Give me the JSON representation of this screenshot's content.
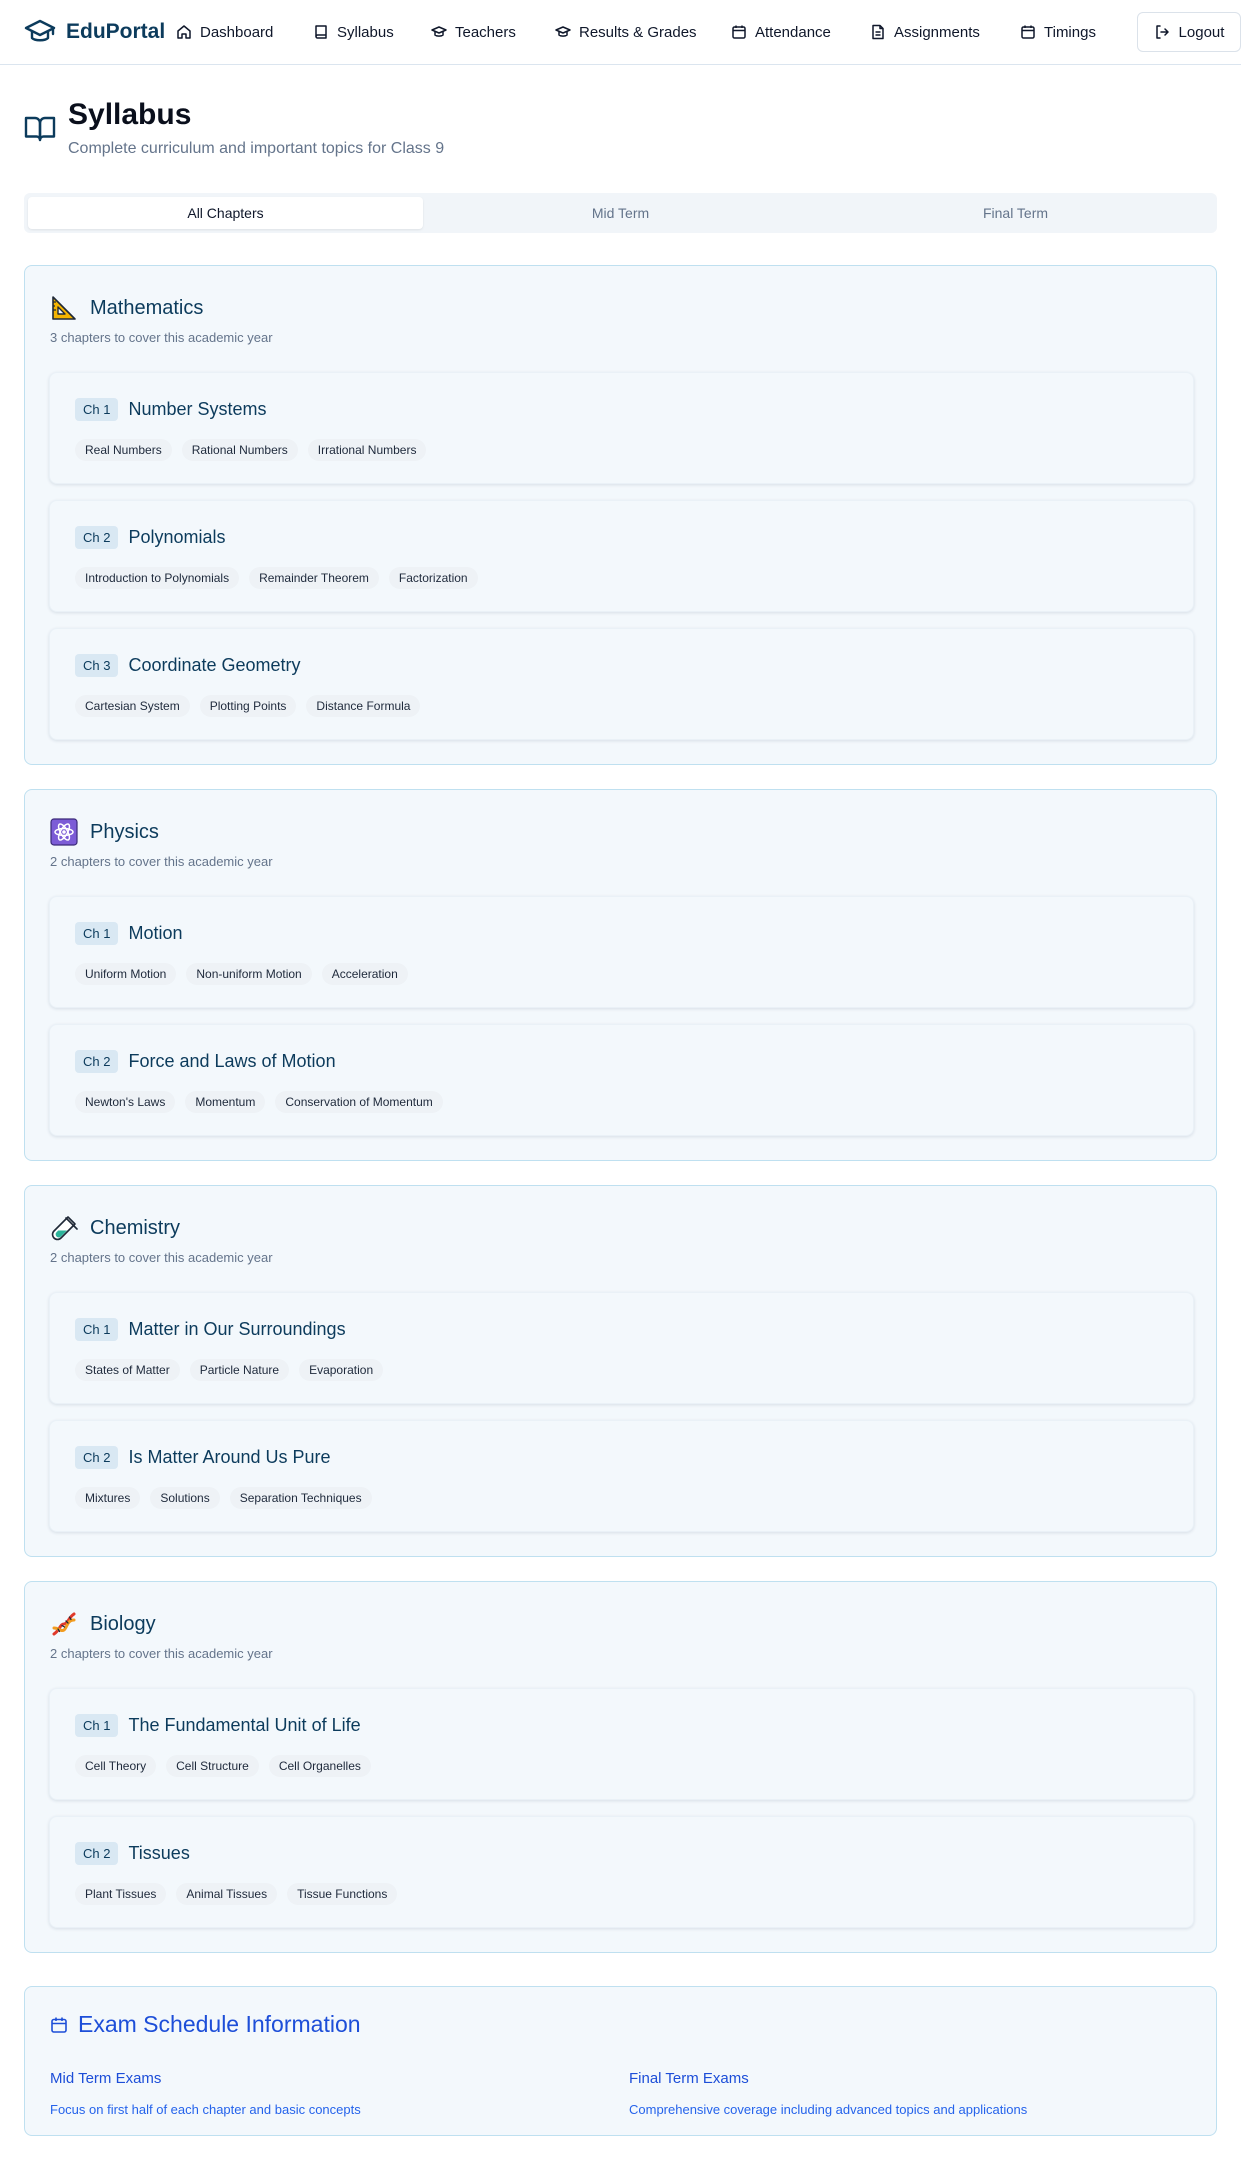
{
  "app": {
    "name": "EduPortal"
  },
  "nav": {
    "items": [
      {
        "label": "Dashboard",
        "icon": "home-icon"
      },
      {
        "label": "Syllabus",
        "icon": "book-icon"
      },
      {
        "label": "Teachers",
        "icon": "graduation-cap-icon"
      },
      {
        "label": "Results & Grades",
        "icon": "graduation-cap-icon"
      },
      {
        "label": "Attendance",
        "icon": "calendar-icon"
      },
      {
        "label": "Assignments",
        "icon": "document-icon"
      },
      {
        "label": "Timings",
        "icon": "calendar-icon"
      }
    ],
    "logout_label": "Logout"
  },
  "page": {
    "title": "Syllabus",
    "subtitle": "Complete curriculum and important topics for Class 9"
  },
  "tabs": [
    {
      "label": "All Chapters",
      "active": true
    },
    {
      "label": "Mid Term",
      "active": false
    },
    {
      "label": "Final Term",
      "active": false
    }
  ],
  "subjects": [
    {
      "name": "Mathematics",
      "icon": "triangle-ruler-icon",
      "description": "3 chapters to cover this academic year",
      "chapters": [
        {
          "badge": "Ch 1",
          "title": "Number Systems",
          "topics": [
            "Real Numbers",
            "Rational Numbers",
            "Irrational Numbers"
          ]
        },
        {
          "badge": "Ch 2",
          "title": "Polynomials",
          "topics": [
            "Introduction to Polynomials",
            "Remainder Theorem",
            "Factorization"
          ]
        },
        {
          "badge": "Ch 3",
          "title": "Coordinate Geometry",
          "topics": [
            "Cartesian System",
            "Plotting Points",
            "Distance Formula"
          ]
        }
      ]
    },
    {
      "name": "Physics",
      "icon": "atom-icon",
      "description": "2 chapters to cover this academic year",
      "chapters": [
        {
          "badge": "Ch 1",
          "title": "Motion",
          "topics": [
            "Uniform Motion",
            "Non-uniform Motion",
            "Acceleration"
          ]
        },
        {
          "badge": "Ch 2",
          "title": "Force and Laws of Motion",
          "topics": [
            "Newton's Laws",
            "Momentum",
            "Conservation of Momentum"
          ]
        }
      ]
    },
    {
      "name": "Chemistry",
      "icon": "test-tube-icon",
      "description": "2 chapters to cover this academic year",
      "chapters": [
        {
          "badge": "Ch 1",
          "title": "Matter in Our Surroundings",
          "topics": [
            "States of Matter",
            "Particle Nature",
            "Evaporation"
          ]
        },
        {
          "badge": "Ch 2",
          "title": "Is Matter Around Us Pure",
          "topics": [
            "Mixtures",
            "Solutions",
            "Separation Techniques"
          ]
        }
      ]
    },
    {
      "name": "Biology",
      "icon": "dna-icon",
      "description": "2 chapters to cover this academic year",
      "chapters": [
        {
          "badge": "Ch 1",
          "title": "The Fundamental Unit of Life",
          "topics": [
            "Cell Theory",
            "Cell Structure",
            "Cell Organelles"
          ]
        },
        {
          "badge": "Ch 2",
          "title": "Tissues",
          "topics": [
            "Plant Tissues",
            "Animal Tissues",
            "Tissue Functions"
          ]
        }
      ]
    }
  ],
  "exam_info": {
    "title": "Exam Schedule Information",
    "mid_term": {
      "title": "Mid Term Exams",
      "description": "Focus on first half of each chapter and basic concepts"
    },
    "final_term": {
      "title": "Final Term Exams",
      "description": "Comprehensive coverage including advanced topics and applications"
    }
  },
  "colors": {
    "brand": "#0c3b5c",
    "accent_blue": "#1d4ed8",
    "card_bg": "#f3f8fc",
    "card_border": "#bfe0f0"
  }
}
